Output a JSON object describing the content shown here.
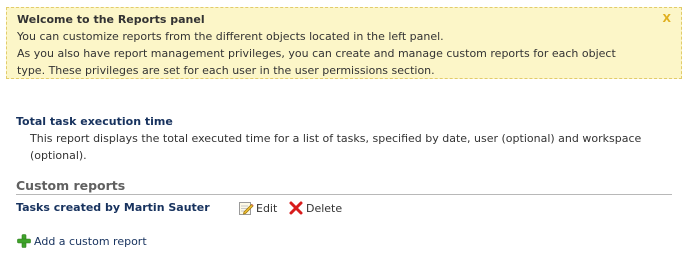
{
  "notice": {
    "title": "Welcome to the Reports panel",
    "close_label": "X",
    "lines": [
      "You can customize reports from the different objects located in the left panel.",
      "As you also have report management privileges, you can create and manage custom reports for each object",
      "type. These privileges are set for each user in the user permissions section."
    ]
  },
  "report": {
    "title": "Total task execution time",
    "description": "This report displays the total executed time for a list of tasks, specified by date, user (optional) and workspace (optional)."
  },
  "custom_reports": {
    "heading": "Custom reports",
    "items": [
      {
        "name": "Tasks created by Martin Sauter",
        "edit_label": "Edit",
        "delete_label": "Delete"
      }
    ],
    "add_label": "Add a custom report"
  },
  "icons": {
    "edit": "pencil-note-icon",
    "delete": "red-x-icon",
    "add": "green-plus-icon"
  },
  "colors": {
    "notice_bg": "#fcf6c8",
    "notice_border": "#e2cc6a",
    "link_blue": "#17325e",
    "close_orange": "#e0b020"
  }
}
